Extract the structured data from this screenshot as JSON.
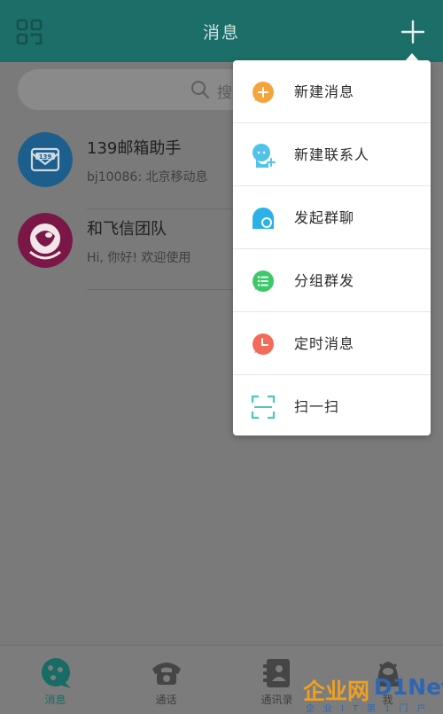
{
  "header": {
    "title": "消息",
    "left_icon": "grid-icon",
    "right_icon": "plus-icon"
  },
  "search": {
    "placeholder": "搜"
  },
  "conversations": [
    {
      "name": "139邮箱助手",
      "preview": "bj10086: 北京移动息",
      "avatar": "mail-139-icon",
      "avatar_color": "#1d73b8"
    },
    {
      "name": "和飞信团队",
      "preview": "Hi, 你好! 欢迎使用",
      "avatar": "hefeixin-icon",
      "avatar_color": "#b0165e"
    }
  ],
  "menu": {
    "items": [
      {
        "label": "新建消息",
        "icon": "new-message-icon",
        "color": "#f5a43b"
      },
      {
        "label": "新建联系人",
        "icon": "new-contact-icon",
        "color": "#4fc3e8"
      },
      {
        "label": "发起群聊",
        "icon": "group-chat-icon",
        "color": "#2bb0e8"
      },
      {
        "label": "分组群发",
        "icon": "group-send-icon",
        "color": "#3ec86b"
      },
      {
        "label": "定时消息",
        "icon": "timed-message-icon",
        "color": "#f26b5b"
      },
      {
        "label": "扫一扫",
        "icon": "scan-icon",
        "color": "#4cc7b8"
      }
    ]
  },
  "tabs": [
    {
      "label": "消息",
      "icon": "message-tab-icon",
      "active": true
    },
    {
      "label": "通话",
      "icon": "phone-tab-icon",
      "active": false
    },
    {
      "label": "通讯录",
      "icon": "contacts-tab-icon",
      "active": false
    },
    {
      "label": "我",
      "icon": "me-tab-icon",
      "active": false
    }
  ],
  "watermark": {
    "text": "企业网",
    "brand": "D1Net",
    "sub": "企业IT第1门户"
  },
  "colors": {
    "header_bg": "#1b6f68",
    "accent": "#176c65",
    "overlay": "#7a7a7a"
  }
}
